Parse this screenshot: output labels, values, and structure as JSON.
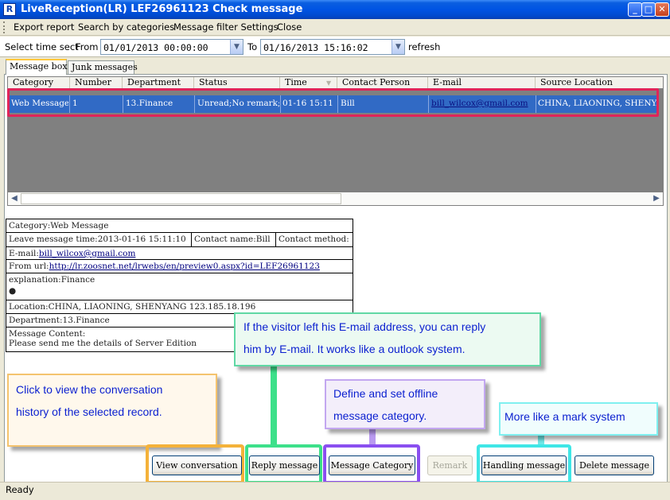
{
  "window": {
    "title": "LiveReception(LR) LEF26961123  Check message",
    "app_icon_letter": "R",
    "controls": {
      "minimize": "_",
      "maximize": "□",
      "close": "✕"
    }
  },
  "menu": {
    "items": [
      "Export report",
      "Search by categories",
      "Message filter Settings",
      "Close"
    ]
  },
  "time_filter": {
    "label": "Select time sect",
    "from_label": "From",
    "from_value": "01/01/2013 00:00:00",
    "to_label": "To",
    "to_value": "01/16/2013 15:16:02",
    "refresh_label": "refresh"
  },
  "tabs": [
    "Message box",
    "Junk messages"
  ],
  "grid": {
    "columns": [
      "Category",
      "Number",
      "Department",
      "Status",
      "Time",
      "Contact Person",
      "E-mail",
      "Source Location"
    ],
    "rows": [
      {
        "category": "Web Message",
        "number": "1",
        "department": "13.Finance",
        "status": "Unread;No remark;",
        "time": "01-16 15:11",
        "contact": "Bill",
        "email": "bill_wilcox@gmail.com",
        "location": "CHINA, LIAONING, SHENYANG"
      }
    ]
  },
  "detail": {
    "category": "Category:Web Message",
    "leave_time": "Leave message time:2013-01-16 15:11:10",
    "contact_name": "Contact name:Bill",
    "contact_method": "Contact method:",
    "email_label": "E-mail:",
    "email_value": "bill_wilcox@gmail.com",
    "from_url_label": "From url:",
    "from_url_value": "http://lr.zoosnet.net/lrwebs/en/preview0.aspx?id=LEF26961123",
    "explanation": "explanation:Finance",
    "bullet": "●",
    "location": "Location:CHINA, LIAONING, SHENYANG 123.185.18.196",
    "department": "Department:13.Finance",
    "message_content_label": "Message Content:",
    "message_content": "Please send me the details of Server Edition"
  },
  "callouts": {
    "email": [
      "If the visitor left his E-mail address, you can reply",
      "him by E-mail. It works like a outlook system."
    ],
    "history": [
      "Click to view the conversation",
      "history of the selected record."
    ],
    "category": [
      "Define and set offline",
      "message category."
    ],
    "mark": [
      "More like a mark system"
    ]
  },
  "colors": {
    "ring_view": "#f4b23a",
    "ring_reply": "#3de08a",
    "ring_category": "#8a4ff0",
    "ring_handling": "#3fe6e6",
    "row_highlight": "#e0245a",
    "selection": "#316ac5"
  },
  "buttons": {
    "view_conversation": "View conversation",
    "reply_message": "Reply message",
    "message_category": "Message Category",
    "remark": "Remark",
    "handling_message": "Handling message",
    "delete_message": "Delete message"
  },
  "status": "Ready"
}
